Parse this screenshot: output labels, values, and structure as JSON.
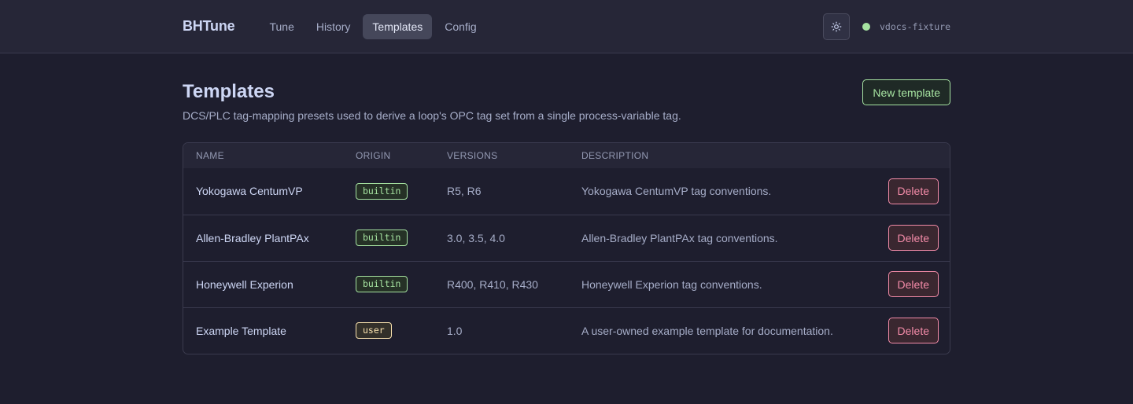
{
  "header": {
    "brand": "BHTune",
    "nav": [
      {
        "label": "Tune",
        "active": false
      },
      {
        "label": "History",
        "active": false
      },
      {
        "label": "Templates",
        "active": true
      },
      {
        "label": "Config",
        "active": false
      }
    ],
    "theme_icon": "sun-icon",
    "connection": {
      "name": "vdocs-fixture",
      "status_color": "#a6e3a1"
    }
  },
  "page": {
    "title": "Templates",
    "subtitle": "DCS/PLC tag-mapping presets used to derive a loop's OPC tag set from a single process-variable tag.",
    "new_button": "New template"
  },
  "table": {
    "columns": [
      "NAME",
      "ORIGIN",
      "VERSIONS",
      "DESCRIPTION"
    ],
    "rows": [
      {
        "name": "Yokogawa CentumVP",
        "origin": "builtin",
        "versions": "R5, R6",
        "description": "Yokogawa CentumVP tag conventions.",
        "action": "Delete"
      },
      {
        "name": "Allen-Bradley PlantPAx",
        "origin": "builtin",
        "versions": "3.0, 3.5, 4.0",
        "description": "Allen-Bradley PlantPAx tag conventions.",
        "action": "Delete"
      },
      {
        "name": "Honeywell Experion",
        "origin": "builtin",
        "versions": "R400, R410, R430",
        "description": "Honeywell Experion tag conventions.",
        "action": "Delete"
      },
      {
        "name": "Example Template",
        "origin": "user",
        "versions": "1.0",
        "description": "A user-owned example template for documentation.",
        "action": "Delete"
      }
    ]
  },
  "colors": {
    "accent_green": "#a6e3a1",
    "accent_red": "#f38ba8",
    "accent_yellow": "#f9e2af",
    "background": "#1e1e2e"
  }
}
